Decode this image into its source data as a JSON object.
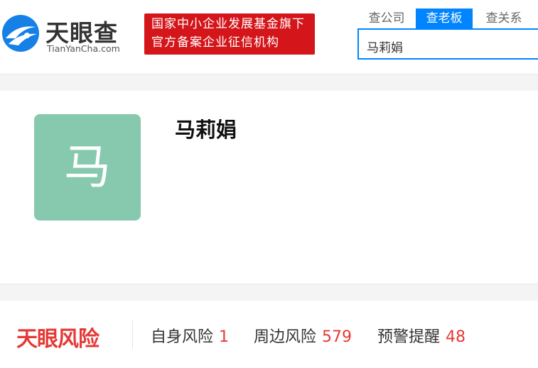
{
  "brand": {
    "name_cn": "天眼查",
    "name_en": "TianYanCha.com",
    "banner_line1": "国家中小企业发展基金旗下",
    "banner_line2": "官方备案企业征信机构",
    "logo_color": "#1581e6",
    "banner_color": "#d4161b"
  },
  "search": {
    "tabs": [
      {
        "label": "查公司",
        "active": false
      },
      {
        "label": "查老板",
        "active": true
      },
      {
        "label": "查关系",
        "active": false
      }
    ],
    "value": "马莉娟",
    "accent_color": "#0084ff"
  },
  "profile": {
    "avatar_char": "马",
    "avatar_color": "#86c9af",
    "name": "马莉娟"
  },
  "risk": {
    "logo_text": "天眼风险",
    "items": [
      {
        "label": "自身风险",
        "count": "1"
      },
      {
        "label": "周边风险",
        "count": "579"
      },
      {
        "label": "预警提醒",
        "count": "48"
      }
    ],
    "accent_color": "#e53935"
  }
}
